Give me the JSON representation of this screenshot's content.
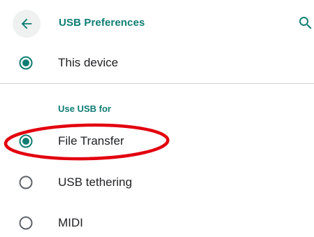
{
  "header": {
    "title": "USB Preferences",
    "back_icon": "arrow-back-icon",
    "search_icon": "search-icon"
  },
  "device_row": {
    "label": "This device",
    "selected": true
  },
  "section": {
    "title": "Use USB for"
  },
  "usb_options": [
    {
      "label": "File Transfer",
      "selected": true
    },
    {
      "label": "USB tethering",
      "selected": false
    },
    {
      "label": "MIDI",
      "selected": false
    }
  ],
  "colors": {
    "accent": "#0f7d73",
    "text": "#202124",
    "radio_unselected": "#5f6368",
    "annotation": "#e3000f",
    "divider": "#d5d5d5"
  }
}
